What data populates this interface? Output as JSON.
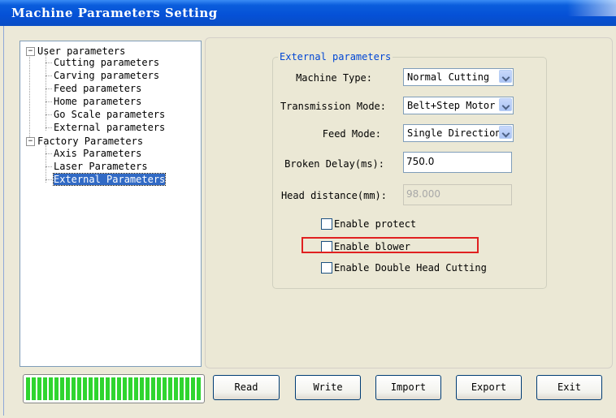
{
  "window": {
    "title": "Machine Parameters Setting"
  },
  "tree": {
    "user_group": "User parameters",
    "user_items": [
      "Cutting parameters",
      "Carving parameters",
      "Feed parameters",
      "Home parameters",
      "Go Scale parameters",
      "External parameters"
    ],
    "factory_group": "Factory Parameters",
    "factory_items": [
      "Axis Parameters",
      "Laser Parameters",
      "External Parameters"
    ],
    "expander_symbol": "−"
  },
  "external": {
    "group_title": "External parameters",
    "machine_type": {
      "label": "Machine Type:",
      "value": "Normal Cutting"
    },
    "transmission_mode": {
      "label": "Transmission Mode:",
      "value": "Belt+Step Motor"
    },
    "feed_mode": {
      "label": "Feed Mode:",
      "value": "Single Direction"
    },
    "broken_delay": {
      "label": "Broken Delay(ms):",
      "value": "750.0"
    },
    "head_distance": {
      "label": "Head distance(mm):",
      "value": "98.000"
    },
    "enable_protect": "Enable protect",
    "enable_blower": "Enable blower",
    "enable_double_head": "Enable Double Head Cutting"
  },
  "progress": {
    "value": 1.0,
    "color": "#2fd52f"
  },
  "buttons": {
    "read": "Read",
    "write": "Write",
    "import": "Import",
    "export": "Export",
    "exit": "Exit"
  },
  "colors": {
    "titlebar": "#0550d6",
    "selection": "#316ac5",
    "group_title": "#0046d5",
    "highlight_border": "#e02020"
  }
}
